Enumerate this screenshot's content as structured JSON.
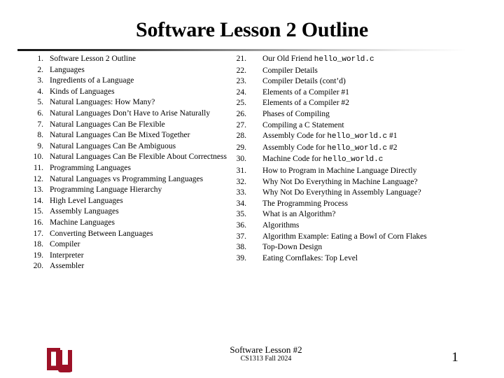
{
  "slide": {
    "title": "Software Lesson 2 Outline",
    "footer": {
      "line1": "Software Lesson #2",
      "line2": "CS1313 Fall 2024",
      "page_number": "1",
      "logo_name": "ou-logo",
      "logo_color": "#9d1127"
    }
  },
  "outline": {
    "left": [
      {
        "num": "1.",
        "text": "Software Lesson 2 Outline"
      },
      {
        "num": "2.",
        "text": "Languages"
      },
      {
        "num": "3.",
        "text": "Ingredients of a Language"
      },
      {
        "num": "4.",
        "text": "Kinds of Languages"
      },
      {
        "num": "5.",
        "text": "Natural Languages: How Many?"
      },
      {
        "num": "6.",
        "text": "Natural Languages Don’t Have to Arise Naturally"
      },
      {
        "num": "7.",
        "text": "Natural Languages Can Be Flexible"
      },
      {
        "num": "8.",
        "text": "Natural Languages Can Be Mixed Together"
      },
      {
        "num": "9.",
        "text": "Natural Languages Can Be Ambiguous"
      },
      {
        "num": "10.",
        "text": "Natural Languages Can Be Flexible About Correctness"
      },
      {
        "num": "11.",
        "text": "Programming Languages"
      },
      {
        "num": "12.",
        "text": "Natural Languages vs Programming Languages"
      },
      {
        "num": "13.",
        "text": "Programming Language Hierarchy"
      },
      {
        "num": "14.",
        "text": "High Level Languages"
      },
      {
        "num": "15.",
        "text": "Assembly Languages"
      },
      {
        "num": "16.",
        "text": "Machine Languages"
      },
      {
        "num": "17.",
        "text": "Converting Between Languages"
      },
      {
        "num": "18.",
        "text": "Compiler"
      },
      {
        "num": "19.",
        "text": "Interpreter"
      },
      {
        "num": "20.",
        "text": "Assembler"
      }
    ],
    "right": [
      {
        "num": "21.",
        "pre": "Our Old Friend ",
        "code": "hello_world.c",
        "post": ""
      },
      {
        "num": "22.",
        "pre": "Compiler Details",
        "code": "",
        "post": ""
      },
      {
        "num": "23.",
        "pre": "Compiler Details (cont’d)",
        "code": "",
        "post": ""
      },
      {
        "num": "24.",
        "pre": "Elements of a Compiler #1",
        "code": "",
        "post": ""
      },
      {
        "num": "25.",
        "pre": "Elements of a Compiler #2",
        "code": "",
        "post": ""
      },
      {
        "num": "26.",
        "pre": "Phases of Compiling",
        "code": "",
        "post": ""
      },
      {
        "num": "27.",
        "pre": "Compiling a C Statement",
        "code": "",
        "post": ""
      },
      {
        "num": "28.",
        "pre": "Assembly Code for ",
        "code": "hello_world.c",
        "post": " #1"
      },
      {
        "num": "29.",
        "pre": "Assembly Code for ",
        "code": "hello_world.c",
        "post": " #2"
      },
      {
        "num": "30.",
        "pre": "Machine Code for ",
        "code": "hello_world.c",
        "post": ""
      },
      {
        "num": "31.",
        "pre": "How to Program in Machine Language Directly",
        "code": "",
        "post": ""
      },
      {
        "num": "32.",
        "pre": "Why Not Do Everything in Machine Language?",
        "code": "",
        "post": ""
      },
      {
        "num": "33.",
        "pre": "Why Not Do Everything in Assembly Language?",
        "code": "",
        "post": ""
      },
      {
        "num": "34.",
        "pre": "The Programming Process",
        "code": "",
        "post": ""
      },
      {
        "num": "35.",
        "pre": "What is an Algorithm?",
        "code": "",
        "post": ""
      },
      {
        "num": "36.",
        "pre": "Algorithms",
        "code": "",
        "post": ""
      },
      {
        "num": "37.",
        "pre": "Algorithm Example: Eating a Bowl of Corn Flakes",
        "code": "",
        "post": ""
      },
      {
        "num": "38.",
        "pre": "Top-Down Design",
        "code": "",
        "post": ""
      },
      {
        "num": "39.",
        "pre": "Eating Cornflakes: Top Level",
        "code": "",
        "post": ""
      }
    ]
  }
}
